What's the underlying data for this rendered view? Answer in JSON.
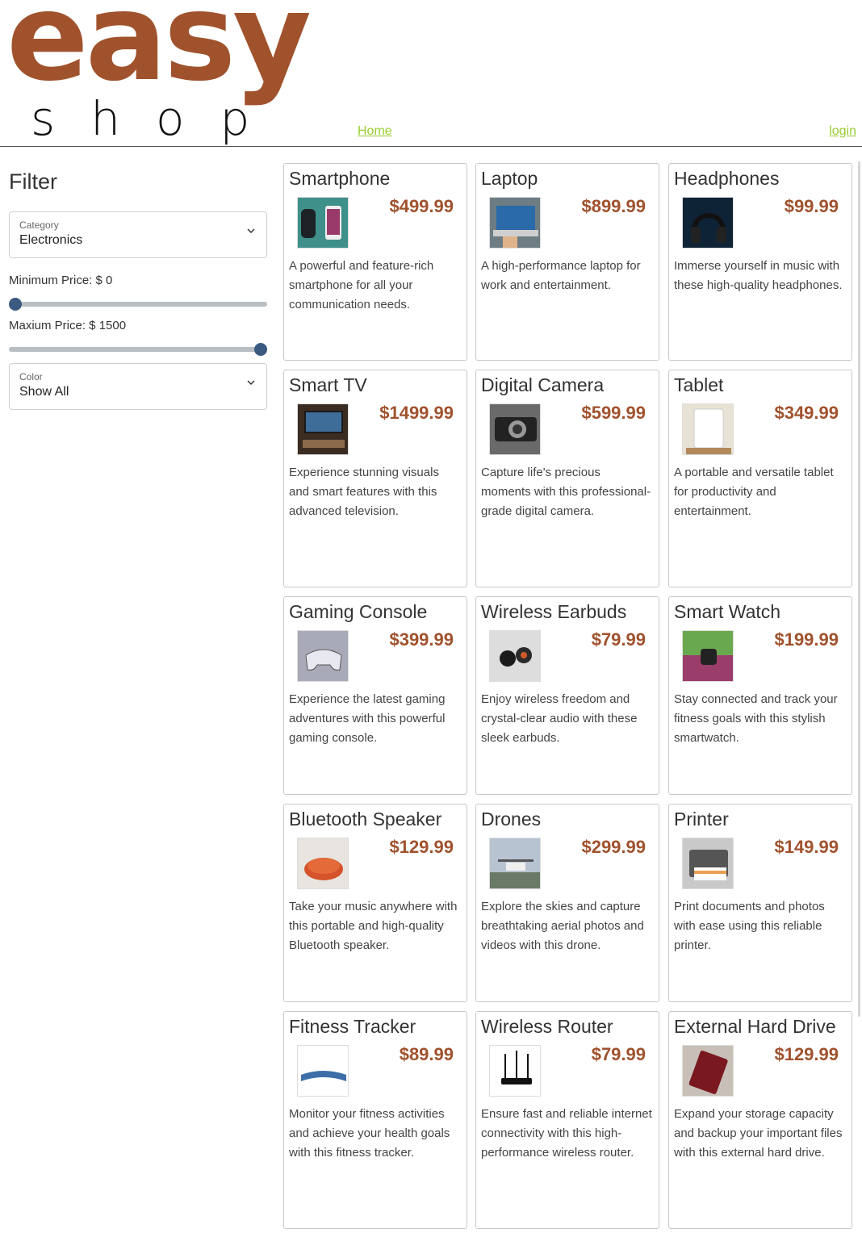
{
  "header": {
    "logo_top": "easy",
    "logo_bottom": "shop",
    "nav_home": "Home",
    "nav_login": "login",
    "accent_color": "#a0522d",
    "link_color": "#9acd32"
  },
  "filter": {
    "title": "Filter",
    "category": {
      "label": "Category",
      "value": "Electronics"
    },
    "min_price": {
      "label": "Minimum Price: $ 0",
      "value": 0
    },
    "max_price": {
      "label": "Maxium Price: $ 1500",
      "value": 1500
    },
    "color": {
      "label": "Color",
      "value": "Show All"
    }
  },
  "products": [
    {
      "name": "Smartphone",
      "price": "$499.99",
      "desc": "A powerful and feature-rich smartphone for all your communication needs.",
      "img": "smartphone"
    },
    {
      "name": "Laptop",
      "price": "$899.99",
      "desc": "A high-performance laptop for work and entertainment.",
      "img": "laptop"
    },
    {
      "name": "Headphones",
      "price": "$99.99",
      "desc": "Immerse yourself in music with these high-quality headphones.",
      "img": "headphones"
    },
    {
      "name": "Smart TV",
      "price": "$1499.99",
      "desc": "Experience stunning visuals and smart features with this advanced television.",
      "img": "tv"
    },
    {
      "name": "Digital Camera",
      "price": "$599.99",
      "desc": "Capture life's precious moments with this professional-grade digital camera.",
      "img": "camera"
    },
    {
      "name": "Tablet",
      "price": "$349.99",
      "desc": "A portable and versatile tablet for productivity and entertainment.",
      "img": "tablet"
    },
    {
      "name": "Gaming Console",
      "price": "$399.99",
      "desc": "Experience the latest gaming adventures with this powerful gaming console.",
      "img": "console"
    },
    {
      "name": "Wireless Earbuds",
      "price": "$79.99",
      "desc": "Enjoy wireless freedom and crystal-clear audio with these sleek earbuds.",
      "img": "earbuds"
    },
    {
      "name": "Smart Watch",
      "price": "$199.99",
      "desc": "Stay connected and track your fitness goals with this stylish smartwatch.",
      "img": "watch"
    },
    {
      "name": "Bluetooth Speaker",
      "price": "$129.99",
      "desc": "Take your music anywhere with this portable and high-quality Bluetooth speaker.",
      "img": "speaker"
    },
    {
      "name": "Drones",
      "price": "$299.99",
      "desc": "Explore the skies and capture breathtaking aerial photos and videos with this drone.",
      "img": "drone"
    },
    {
      "name": "Printer",
      "price": "$149.99",
      "desc": "Print documents and photos with ease using this reliable printer.",
      "img": "printer"
    },
    {
      "name": "Fitness Tracker",
      "price": "$89.99",
      "desc": "Monitor your fitness activities and achieve your health goals with this fitness tracker.",
      "img": "tracker"
    },
    {
      "name": "Wireless Router",
      "price": "$79.99",
      "desc": "Ensure fast and reliable internet connectivity with this high-performance wireless router.",
      "img": "router"
    },
    {
      "name": "External Hard Drive",
      "price": "$129.99",
      "desc": "Expand your storage capacity and backup your important files with this external hard drive.",
      "img": "harddrive"
    }
  ]
}
